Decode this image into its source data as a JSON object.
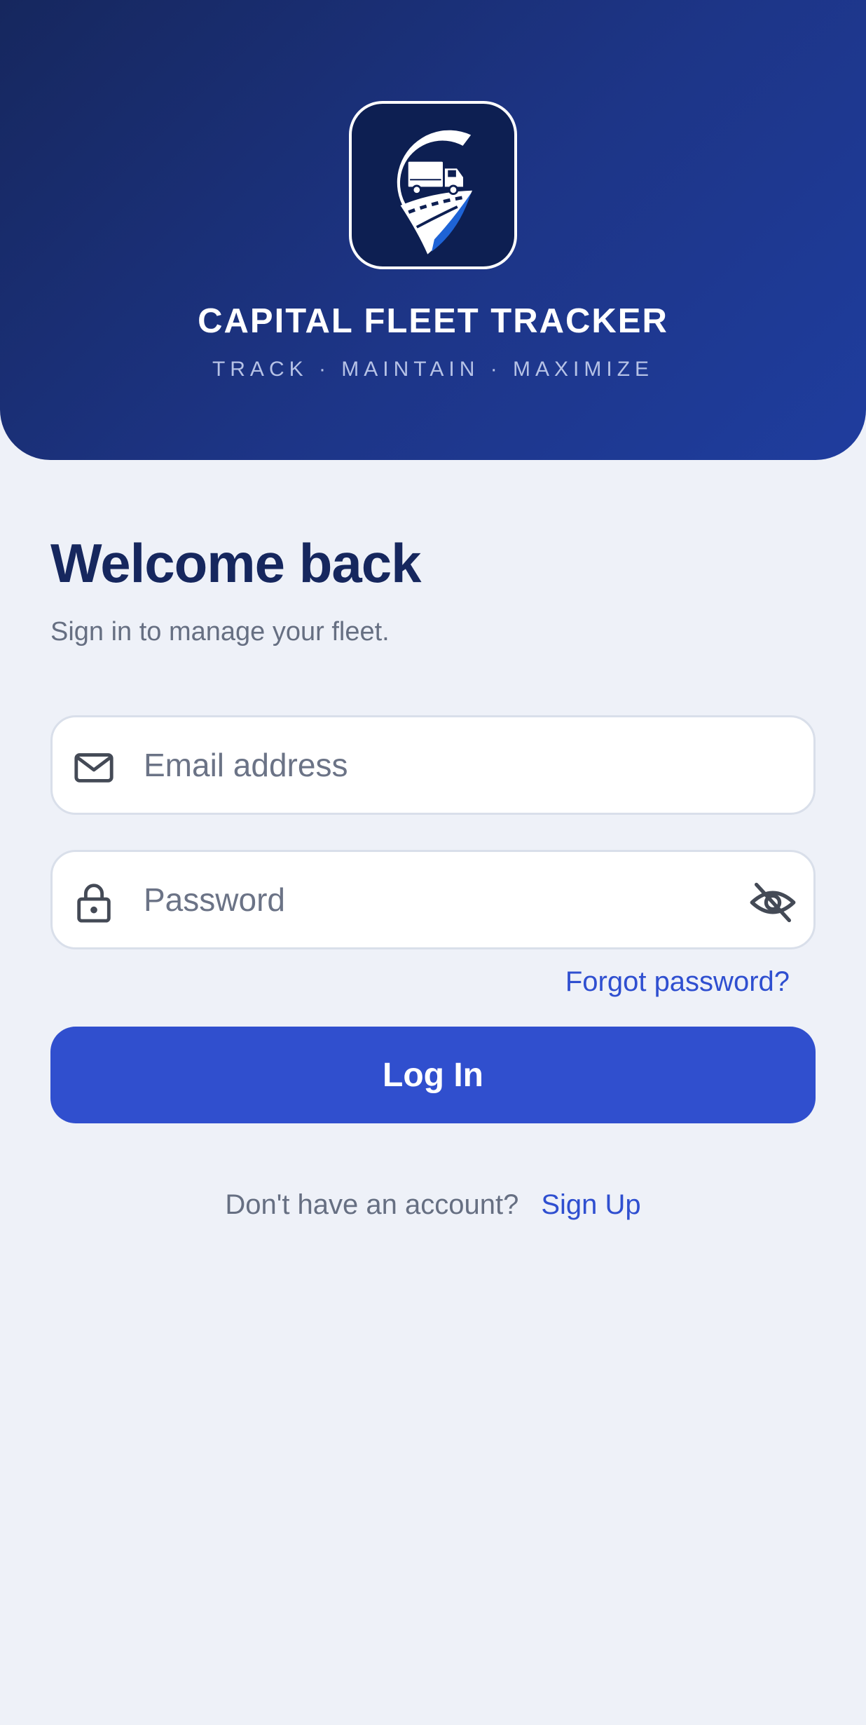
{
  "header": {
    "app_name": "CAPITAL FLEET TRACKER",
    "tagline": "TRACK · MAINTAIN · MAXIMIZE",
    "logo_icon": "truck-location-pin-logo",
    "gradient_colors": [
      "#16275e",
      "#1f3d9e"
    ]
  },
  "main": {
    "title": "Welcome back",
    "subtitle": "Sign in to manage your fleet."
  },
  "form": {
    "email": {
      "placeholder": "Email address",
      "value": "",
      "icon": "mail-icon"
    },
    "password": {
      "placeholder": "Password",
      "value": "",
      "icon": "lock-icon",
      "toggle_icon": "eye-off-icon"
    },
    "forgot_label": "Forgot password?",
    "login_label": "Log In"
  },
  "signup": {
    "prompt": "Don't have an account?",
    "link_label": "Sign Up"
  },
  "colors": {
    "accent": "#304fce",
    "link": "#2f4fd0",
    "heading": "#16275e",
    "background": "#eef1f8"
  }
}
